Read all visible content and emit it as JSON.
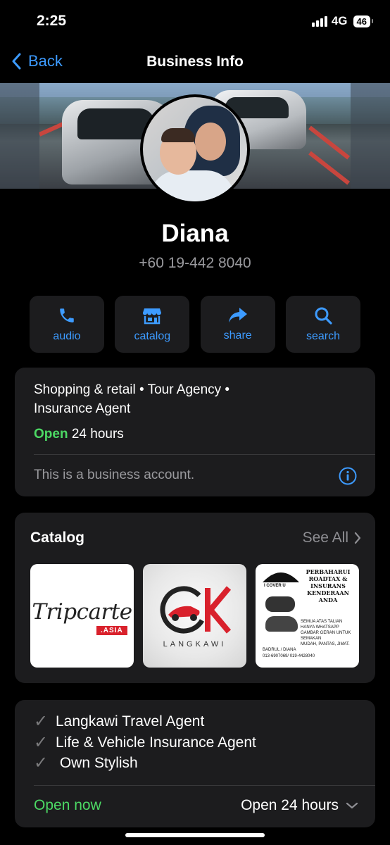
{
  "status_bar": {
    "time": "2:25",
    "network": "4G",
    "battery": "46"
  },
  "nav": {
    "back_label": "Back",
    "title": "Business Info"
  },
  "profile": {
    "name": "Diana",
    "phone": "+60 19-442 8040"
  },
  "actions": [
    {
      "label": "audio",
      "icon": "phone-icon"
    },
    {
      "label": "catalog",
      "icon": "storefront-icon"
    },
    {
      "label": "share",
      "icon": "share-arrow-icon"
    },
    {
      "label": "search",
      "icon": "search-icon"
    }
  ],
  "info": {
    "categories_line1": "Shopping & retail • Tour Agency •",
    "categories_line2": "Insurance Agent",
    "open_label": "Open",
    "hours": "24 hours",
    "note": "This is a business account."
  },
  "catalog": {
    "title": "Catalog",
    "see_all": "See All",
    "items": [
      {
        "brand": "Tripcarte",
        "badge": ".ASIA"
      },
      {
        "brand": "LANGKAWI"
      },
      {
        "brand": "PERBAHARUI ROADTAX & INSURANS KENDERAAN ANDA",
        "tag": "I COVER U",
        "bullets": [
          "SEMUA ATAS TALIAN",
          "HANYA WHATSAPP GAMBAR GERAN UNTUK SEMAKAN",
          "MUDAH, PANTAS, JIMAT."
        ],
        "footer_name": "BADRUL / DIANA",
        "footer_phone": "013-6907069/ 019-4428040"
      }
    ]
  },
  "description": {
    "lines": [
      "Langkawi Travel Agent",
      "Life & Vehicle Insurance Agent",
      " Own Stylish"
    ],
    "open_now": "Open now",
    "hours": "Open 24 hours"
  },
  "colors": {
    "accent": "#3d9bff",
    "open": "#4cd964",
    "card": "#1c1c1e"
  }
}
